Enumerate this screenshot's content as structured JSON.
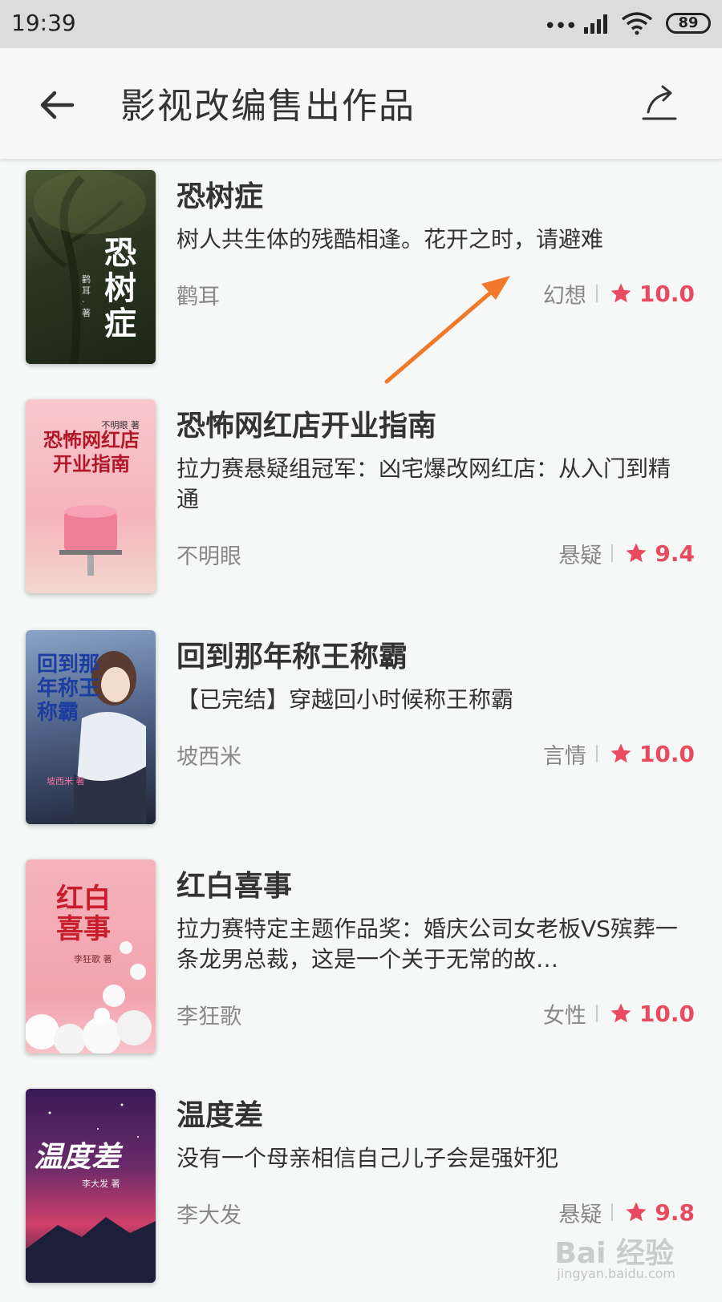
{
  "status": {
    "time": "19:39",
    "battery": "89"
  },
  "header": {
    "title": "影视改编售出作品"
  },
  "books": [
    {
      "title": "恐树症",
      "desc": "树人共生体的残酷相逢。花开之时，请避难",
      "author": "鹳耳",
      "genre": "幻想",
      "score": "10.0",
      "cover": {
        "text": "恐树症",
        "author": "鹳耳·著",
        "bg": "#2f3b22",
        "fg": "#ffffff"
      }
    },
    {
      "title": "恐怖网红店开业指南",
      "desc": "拉力赛悬疑组冠军：凶宅爆改网红店：从入门到精通",
      "author": "不明眼",
      "genre": "悬疑",
      "score": "9.4",
      "cover": {
        "text": "恐怖网红店开业指南",
        "author": "不明眼 著",
        "bg": "#f7c3c8",
        "fg": "#b01828"
      }
    },
    {
      "title": "回到那年称王称霸",
      "desc": "【已完结】穿越回小时候称王称霸",
      "author": "坡西米",
      "genre": "言情",
      "score": "10.0",
      "cover": {
        "text": "回到那年称王称霸",
        "author": "坡西米 著",
        "bg": "#5d6f8f",
        "fg": "#1b3ea0"
      }
    },
    {
      "title": "红白喜事",
      "desc": "拉力赛特定主题作品奖：婚庆公司女老板VS殡葬一条龙男总裁，这是一个关于无常的故…",
      "author": "李狂歌",
      "genre": "女性",
      "score": "10.0",
      "cover": {
        "text": "红白喜事",
        "author": "李狂歌 著",
        "bg": "#f3a9b3",
        "fg": "#c81d2a"
      }
    },
    {
      "title": "温度差",
      "desc": "没有一个母亲相信自己儿子会是强奸犯",
      "author": "李大发",
      "genre": "悬疑",
      "score": "9.8",
      "cover": {
        "text": "温度差",
        "author": "李大发 著",
        "bg": "#2a1a4a",
        "fg": "#ffffff"
      }
    }
  ],
  "watermark": {
    "main": "Bai 经验",
    "sub": "jingyan.baidu.com"
  },
  "colors": {
    "accent": "#e84a5f",
    "arrow": "#f07a2a"
  }
}
